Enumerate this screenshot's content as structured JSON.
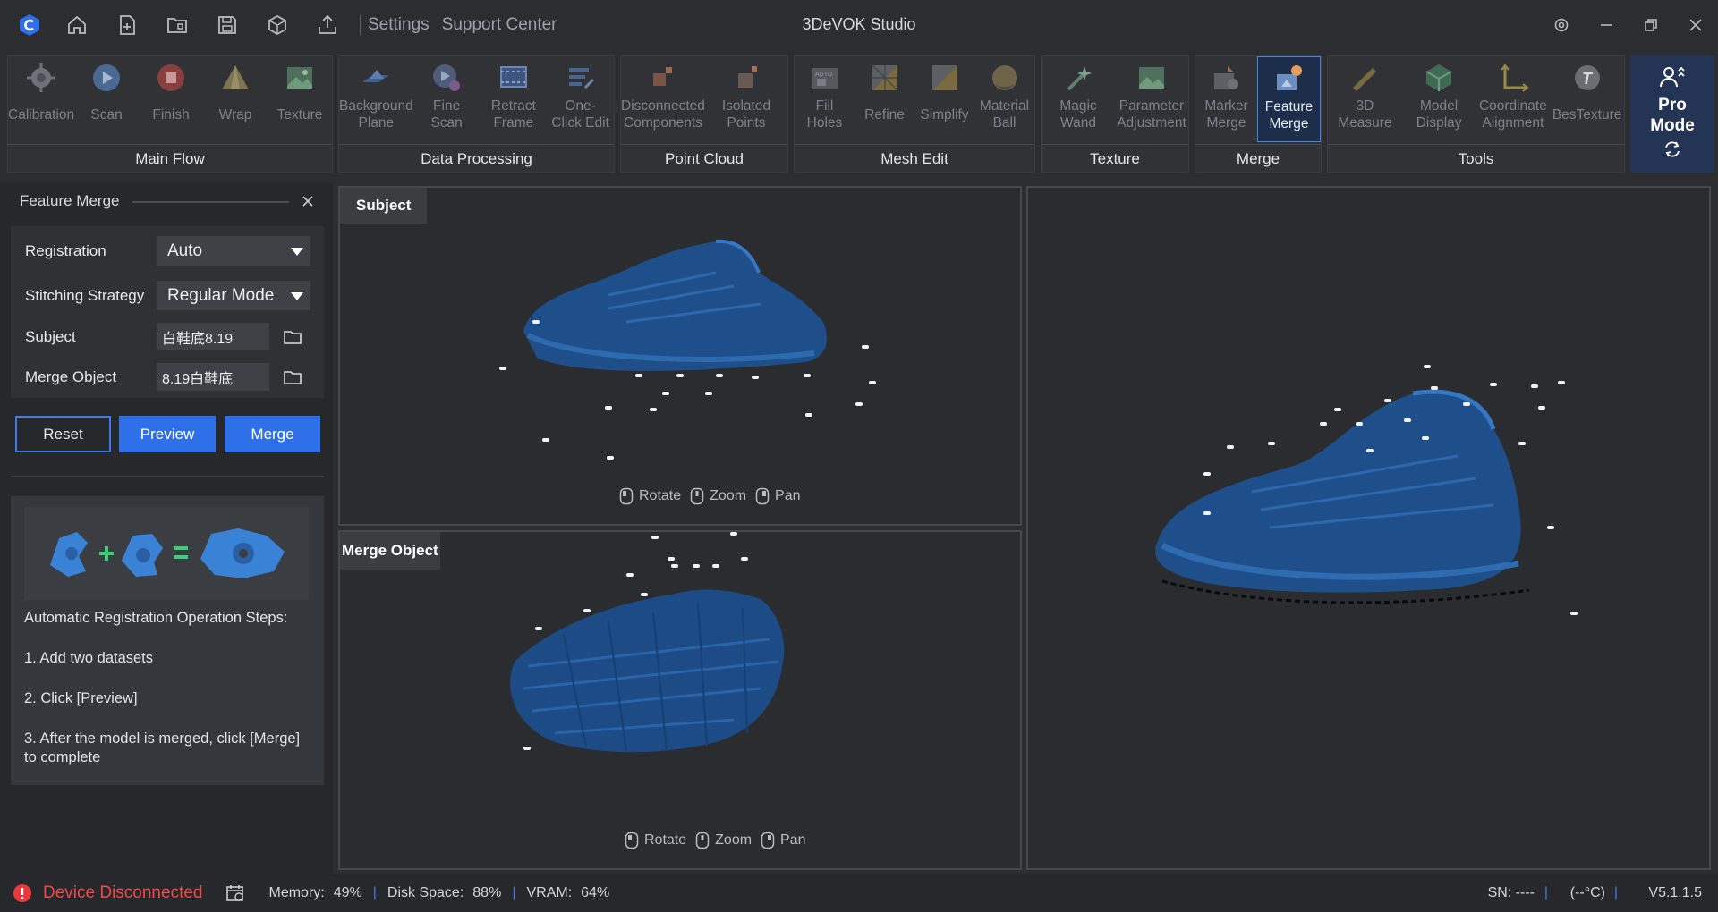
{
  "app": {
    "title": "3DeVOK Studio"
  },
  "titlebar": {
    "links": [
      "Settings",
      "Support Center"
    ],
    "icons": [
      "home-icon",
      "new-project-icon",
      "open-project-icon",
      "save-icon",
      "package-icon",
      "export-icon"
    ]
  },
  "ribbon": {
    "groups": [
      {
        "label": "Main Flow",
        "tools": [
          "Calibration",
          "Scan",
          "Finish",
          "Wrap",
          "Texture"
        ]
      },
      {
        "label": "Data Processing",
        "tools": [
          "Background Plane",
          "Fine Scan",
          "Retract Frame",
          "One-Click Edit"
        ]
      },
      {
        "label": "Point Cloud",
        "tools": [
          "Disconnected Components",
          "Isolated Points"
        ]
      },
      {
        "label": "Mesh Edit",
        "tools": [
          "Fill Holes",
          "Refine",
          "Simplify",
          "Material Ball"
        ]
      },
      {
        "label": "Texture",
        "tools": [
          "Magic Wand",
          "Parameter Adjustment"
        ]
      },
      {
        "label": "Merge",
        "tools": [
          "Marker Merge",
          "Feature Merge"
        ]
      },
      {
        "label": "Tools",
        "tools": [
          "3D Measure",
          "Model Display",
          "Coordinate Alignment",
          "BesTexture"
        ]
      }
    ],
    "pro_mode": "Pro Mode"
  },
  "panel": {
    "title": "Feature Merge",
    "registration_label": "Registration",
    "registration_value": "Auto",
    "strategy_label": "Stitching Strategy",
    "strategy_value": "Regular Mode",
    "subject_label": "Subject",
    "subject_value": "白鞋底8.19",
    "merge_object_label": "Merge Object",
    "merge_object_value": "8.19白鞋底",
    "buttons": {
      "reset": "Reset",
      "preview": "Preview",
      "merge": "Merge"
    },
    "help": {
      "heading": "Automatic Registration Operation Steps:",
      "step1": "1. Add two datasets",
      "step2": "2. Click [Preview]",
      "step3": "3. After the model is merged, click [Merge] to complete"
    }
  },
  "viewports": {
    "subject_tag": "Subject",
    "merge_object_tag": "Merge Object",
    "hints": {
      "rotate": "Rotate",
      "zoom": "Zoom",
      "pan": "Pan"
    }
  },
  "status": {
    "device": "Device Disconnected",
    "memory_label": "Memory:",
    "memory_value": "49%",
    "disk_label": "Disk Space:",
    "disk_value": "88%",
    "vram_label": "VRAM:",
    "vram_value": "64%",
    "sn": "SN: ----",
    "temp": "(--°C)",
    "version": "V5.1.1.5"
  },
  "colors": {
    "accent": "#2f6fea",
    "error": "#f0484b",
    "model": "#1f4f8a"
  }
}
